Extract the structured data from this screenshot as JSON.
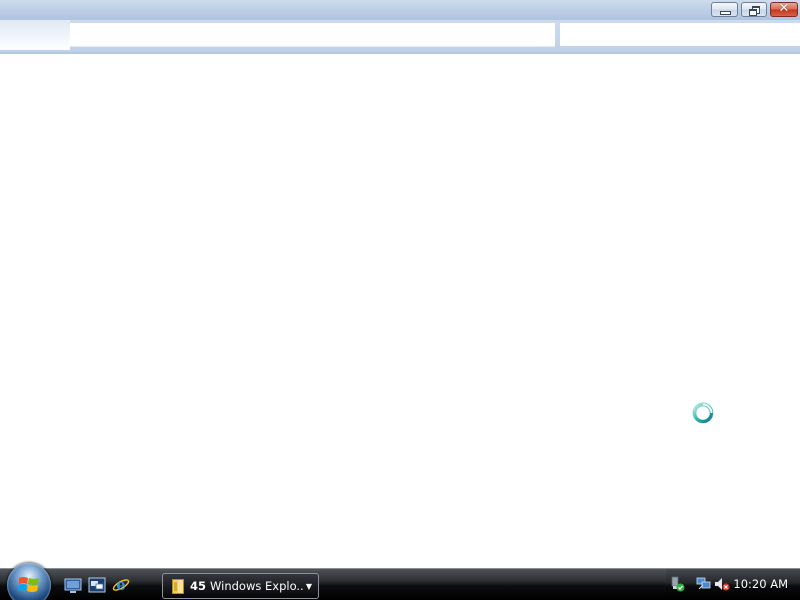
{
  "window": {
    "caption_buttons": [
      {
        "name": "minimize",
        "icon": "minimize-icon"
      },
      {
        "name": "maximize",
        "icon": "restore-icon"
      },
      {
        "name": "close",
        "icon": "close-icon",
        "glyph": "✕"
      }
    ],
    "address_value": "",
    "search_value": ""
  },
  "cursor": {
    "state": "busy",
    "icon": "busy-ring-icon"
  },
  "taskbar": {
    "start_icon": "windows-logo-icon",
    "quick_launch": [
      "show-desktop-icon",
      "switch-windows-icon",
      "internet-explorer-icon"
    ],
    "task_button": {
      "count": "45",
      "label": "Windows Explo...",
      "icon": "folder-icon",
      "dropdown_icon": "▼"
    },
    "tray": {
      "icons": [
        "safely-remove-hardware-icon",
        "network-disconnected-icon",
        "volume-muted-icon"
      ],
      "clock": "10:20 AM"
    }
  },
  "colors": {
    "titlebar": "#bdd0e7",
    "taskbar": "#000000",
    "close_button": "#c2351c"
  }
}
